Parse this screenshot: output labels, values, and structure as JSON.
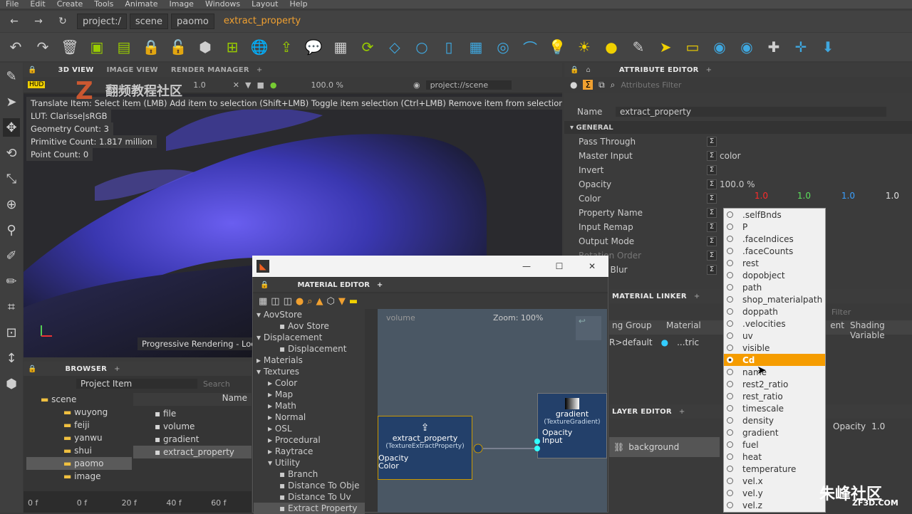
{
  "menu": [
    "File",
    "Edit",
    "Create",
    "Tools",
    "Animate",
    "Image",
    "Windows",
    "Layout",
    "Help"
  ],
  "nav": {
    "crumbs": [
      "project:/",
      "scene",
      "paomo"
    ],
    "current": "extract_property"
  },
  "view_tabs": [
    "3D VIEW",
    "IMAGE VIEW",
    "RENDER MANAGER"
  ],
  "viewport": {
    "zoom": "100.0 %",
    "value": "1.0",
    "path": "project://scene",
    "hint": "Translate Item: Select item (LMB)  Add item to selection (Shift+LMB)  Toggle item selection (Ctrl+LMB)  Remove item from selection (Ctrl+Sh",
    "lut": "LUT: Clarisse|sRGB",
    "geometry": "Geometry Count: 3",
    "primitive": "Primitive Count: 1.817 million",
    "points": "Point Count: 0",
    "status": "Progressive Rendering - Looki"
  },
  "attr": {
    "title": "ATTRIBUTE EDITOR",
    "filter": "Attributes Filter",
    "name_label": "Name",
    "name_value": "extract_property",
    "section": "GENERAL",
    "rows": [
      {
        "label": "Pass Through",
        "value": ""
      },
      {
        "label": "Master Input",
        "value": "color"
      },
      {
        "label": "Invert",
        "value": ""
      },
      {
        "label": "Opacity",
        "value": "100.0 %"
      },
      {
        "label": "Color",
        "value": ""
      },
      {
        "label": "Property Name",
        "value": ""
      },
      {
        "label": "Input Remap",
        "value": ""
      },
      {
        "label": "Output Mode",
        "value": ""
      },
      {
        "label": "Rotation Order",
        "value": ""
      },
      {
        "label": "Motion Blur",
        "value": ""
      }
    ],
    "color_vals": [
      "1.0",
      "1.0",
      "1.0",
      "1.0"
    ],
    "colors": {
      "r": "#ff2a2a",
      "g": "#5ce05c",
      "b": "#3aa0ff",
      "a": "#e0e0e0"
    }
  },
  "dropdown": {
    "items": [
      ".selfBnds",
      "P",
      ".faceIndices",
      ".faceCounts",
      "rest",
      "dopobject",
      "path",
      "shop_materialpath",
      "doppath",
      ".velocities",
      "uv",
      "visible",
      "Cd",
      "name",
      "rest2_ratio",
      "rest_ratio",
      "timescale",
      "density",
      "gradient",
      "fuel",
      "heat",
      "temperature",
      "vel.x",
      "vel.y",
      "vel.z"
    ],
    "selected": "Cd"
  },
  "material": {
    "title": "MATERIAL EDITOR",
    "tree": [
      {
        "t": "AovStore",
        "l": 0,
        "a": "▾"
      },
      {
        "t": "Aov Store",
        "l": 2,
        "a": ""
      },
      {
        "t": "Displacement",
        "l": 0,
        "a": "▾"
      },
      {
        "t": "Displacement",
        "l": 2,
        "a": ""
      },
      {
        "t": "Materials",
        "l": 0,
        "a": "▸"
      },
      {
        "t": "Textures",
        "l": 0,
        "a": "▾"
      },
      {
        "t": "Color",
        "l": 1,
        "a": "▸"
      },
      {
        "t": "Map",
        "l": 1,
        "a": "▸"
      },
      {
        "t": "Math",
        "l": 1,
        "a": "▸"
      },
      {
        "t": "Normal",
        "l": 1,
        "a": "▸"
      },
      {
        "t": "OSL",
        "l": 1,
        "a": "▸"
      },
      {
        "t": "Procedural",
        "l": 1,
        "a": "▸"
      },
      {
        "t": "Raytrace",
        "l": 1,
        "a": "▸"
      },
      {
        "t": "Utility",
        "l": 1,
        "a": "▾"
      },
      {
        "t": "Branch",
        "l": 2,
        "a": ""
      },
      {
        "t": "Distance To Obje",
        "l": 2,
        "a": ""
      },
      {
        "t": "Distance To Uv",
        "l": 2,
        "a": ""
      },
      {
        "t": "Extract Property",
        "l": 2,
        "a": ""
      }
    ],
    "graph_name": "volume",
    "zoom": "Zoom: 100%",
    "node1": {
      "title": "extract_property",
      "type": "(TextureExtractProperty)",
      "p1": "Opacity",
      "p2": "Color"
    },
    "node2": {
      "title": "gradient",
      "type": "(TextureGradient)",
      "p1": "Opacity",
      "p2": "Input"
    }
  },
  "browser": {
    "title": "BROWSER",
    "mode": "Project Item",
    "search": "Search",
    "col": "Name",
    "folders": [
      "scene",
      "wuyong",
      "feiji",
      "yanwu",
      "shui",
      "paomo",
      "image"
    ],
    "items": [
      "file",
      "volume",
      "gradient",
      "extract_property"
    ]
  },
  "timeline": [
    "0 f",
    "0 f",
    "20 f",
    "40 f",
    "60 f"
  ],
  "linker": {
    "title": "MATERIAL LINKER",
    "filter": "Filter",
    "cols": [
      "ng Group",
      "Material",
      "ent",
      "Shading Variable"
    ],
    "row": [
      "R>default",
      "...tric"
    ]
  },
  "layer": {
    "title": "LAYER EDITOR",
    "opacity_label": "Opacity",
    "opacity": "1.0",
    "layer": "background"
  },
  "watermark": {
    "top": "翻频教程社区",
    "bottom": "朱峰社区",
    "site": "ZF3D.COM"
  }
}
